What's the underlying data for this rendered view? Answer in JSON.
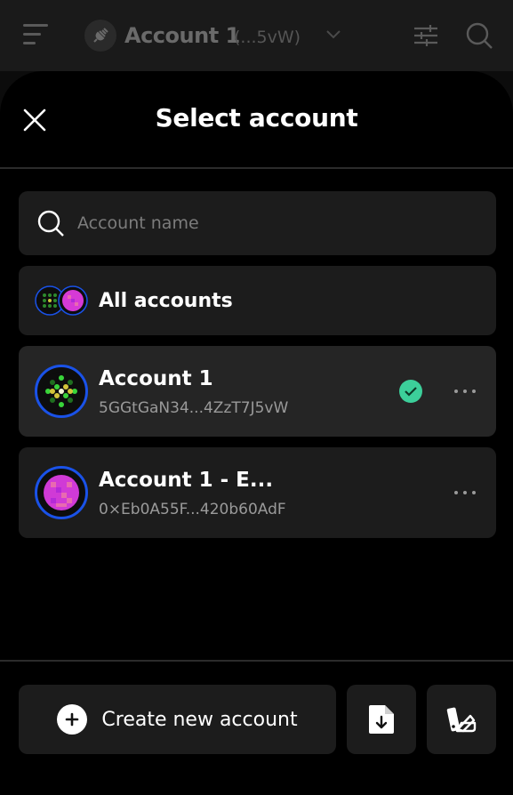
{
  "header": {
    "account_title": "Account 1",
    "account_short_address": "(...5vW)"
  },
  "modal": {
    "title": "Select account"
  },
  "search": {
    "placeholder": "Account name"
  },
  "all_accounts": {
    "label": "All accounts"
  },
  "accounts": [
    {
      "name": "Account 1",
      "address": "5GGtGaN34...4ZzT7J5vW",
      "selected": true,
      "avatar_color": "#39d43a"
    },
    {
      "name": "Account 1 - E...",
      "address": "0×Eb0A55F...420b60AdF",
      "selected": false,
      "avatar_color": "#e040fb"
    }
  ],
  "footer": {
    "create_label": "Create new account"
  },
  "colors": {
    "accent_ring": "#1a52e8",
    "check": "#3ccf9a"
  }
}
